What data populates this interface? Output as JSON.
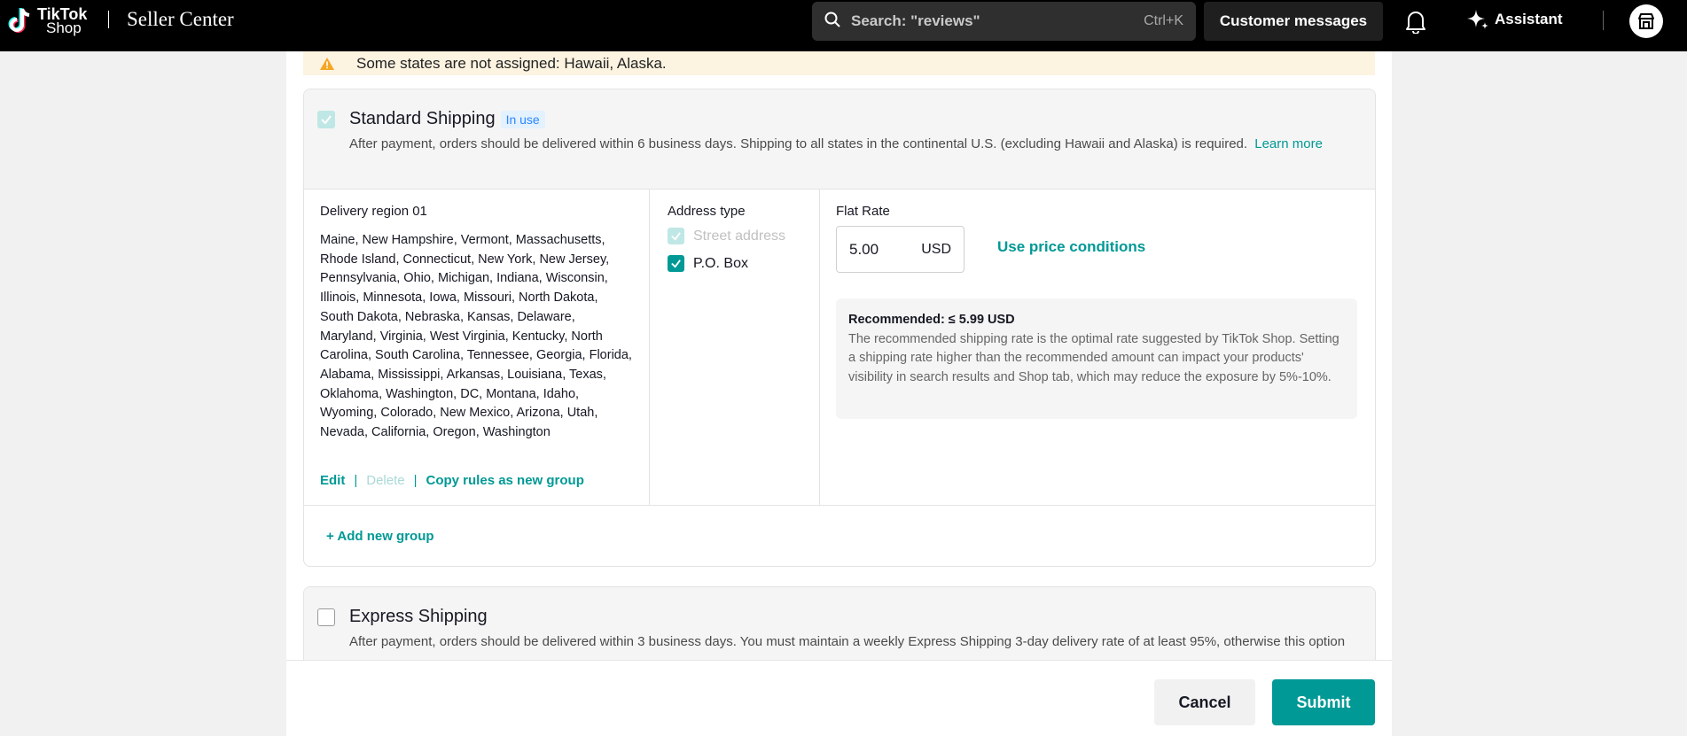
{
  "header": {
    "logo_line1": "TikTok",
    "logo_line2": "Shop",
    "app_title": "Seller Center",
    "search_placeholder": "Search: \"reviews\"",
    "search_shortcut": "Ctrl+K",
    "customer_messages": "Customer messages",
    "assistant": "Assistant",
    "icons": [
      "tiktok-logo-icon",
      "search-icon",
      "bell-icon",
      "sparkle-icon",
      "shop-icon"
    ]
  },
  "warning": {
    "text": "Some states are not assigned: Hawaii, Alaska."
  },
  "standard": {
    "title": "Standard Shipping",
    "badge": "In use",
    "description": "After payment, orders should be delivered within 6 business days. Shipping to all states in the continental U.S. (excluding Hawaii and Alaska) is required.",
    "learn_more": "Learn more",
    "region": {
      "label": "Delivery region 01",
      "states": "Maine, New Hampshire, Vermont, Massachusetts, Rhode Island, Connecticut, New York, New Jersey, Pennsylvania, Ohio, Michigan, Indiana, Wisconsin, Illinois, Minnesota, Iowa, Missouri, North Dakota, South Dakota, Nebraska, Kansas, Delaware, Maryland, Virginia, West Virginia, Kentucky, North Carolina, South Carolina, Tennessee, Georgia, Florida, Alabama, Mississippi, Arkansas, Louisiana, Texas, Oklahoma, Washington, DC, Montana, Idaho, Wyoming, Colorado, New Mexico, Arizona, Utah, Nevada, California, Oregon, Washington",
      "edit": "Edit",
      "delete": "Delete",
      "copy": "Copy rules as new group",
      "separator": "|"
    },
    "address": {
      "label": "Address type",
      "street": "Street address",
      "pobox": "P.O. Box"
    },
    "rate": {
      "label": "Flat Rate",
      "value": "5.00",
      "currency": "USD",
      "price_conditions": "Use price conditions",
      "recommended_title": "Recommended: ≤ 5.99 USD",
      "recommended_text": "The recommended shipping rate is the optimal rate suggested by TikTok Shop. Setting a shipping rate higher than the recommended amount can impact your products' visibility in search results and Shop tab, which may reduce the exposure by 5%-10%."
    },
    "add_group": "+ Add new group"
  },
  "express": {
    "title": "Express Shipping",
    "description": "After payment, orders should be delivered within 3 business days. You must maintain a weekly Express Shipping 3-day delivery rate of at least 95%, otherwise this option"
  },
  "footer": {
    "cancel": "Cancel",
    "submit": "Submit"
  },
  "colors": {
    "accent": "#009995",
    "warning_bg": "#fdf3e1",
    "badge_text": "#2a86ff"
  }
}
